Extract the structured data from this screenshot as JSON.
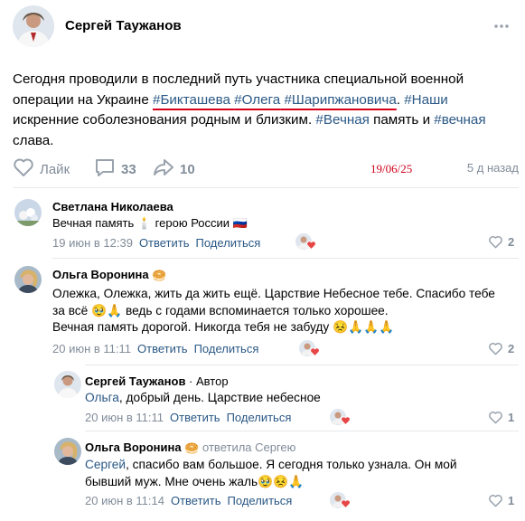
{
  "post": {
    "author": "Сергей Таужанов",
    "text": {
      "p1": "Сегодня проводили в последний путь участника специальной военной операции на Украине ",
      "tag1": "#Бикташева",
      "tag2": "#Олега",
      "tag3": "#Шарипжановича",
      "p2": ". ",
      "tag4": "#Наши",
      "p3": " искренние соболезнования родным и близким. ",
      "tag5": "#Вечная",
      "p4": " память и ",
      "tag6": "#вечная",
      "p5": " слава."
    },
    "actions": {
      "like_label": "Лайк",
      "comments_count": "33",
      "shares_count": "10",
      "handwritten_date": "19/06/25",
      "time_ago": "5 д назад"
    }
  },
  "comments": [
    {
      "name": "Светлана Николаева",
      "text": "Вечная память 🕯️ герою России 🇷🇺",
      "time": "19 июн в 12:39",
      "reply_label": "Ответить",
      "share_label": "Поделиться",
      "likes": "2"
    },
    {
      "name": "Ольга Воронина",
      "badge": "🥯",
      "text_line1": "Олежка, Олежка, жить да жить ещё. Царствие Небесное тебе. Спасибо тебе",
      "text_line2": "за всё 🥹🙏 ведь с годами вспоминается только хорошее.",
      "text_line3": "Вечная память дорогой. Никогда тебя не забуду 😣🙏🙏🙏",
      "time": "20 июн в 11:11",
      "reply_label": "Ответить",
      "share_label": "Поделиться",
      "likes": "2"
    },
    {
      "name": "Сергей Таужанов",
      "author_tag": " · Автор",
      "addressee": "Ольга",
      "text": ", добрый день. Царствие небесное",
      "time": "20 июн в 11:11",
      "reply_label": "Ответить",
      "share_label": "Поделиться",
      "likes": "1"
    },
    {
      "name": "Ольга Воронина",
      "badge": "🥯",
      "replied_to": "ответила Сергею",
      "addressee": "Сергей",
      "text_line1": ", спасибо вам большое. Я сегодня только узнала. Он мой",
      "text_line2": "бывший муж. Мне очень жаль🥹😣🙏",
      "time": "20 июн в 11:14",
      "reply_label": "Ответить",
      "share_label": "Поделиться",
      "likes": "1"
    }
  ],
  "colors": {
    "link": "#2a5885",
    "muted": "#818c99",
    "heart": "#e64646",
    "underline": "#d6001c",
    "date_stamp": "#d0021b"
  },
  "icons": [
    "more-icon",
    "heart-icon",
    "comment-icon",
    "share-icon",
    "heart-reaction-icon"
  ]
}
